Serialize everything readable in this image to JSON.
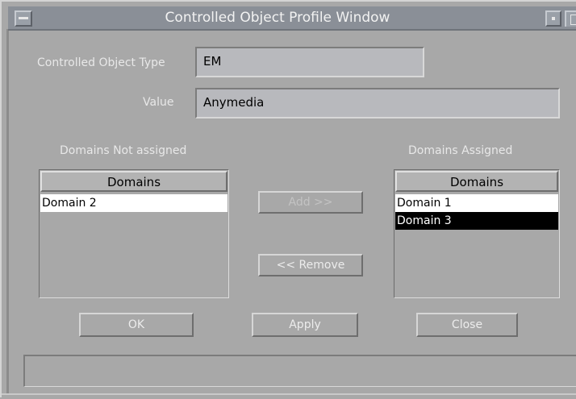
{
  "window": {
    "title": "Controlled Object Profile Window"
  },
  "form": {
    "object_type_label": "Controlled Object Type",
    "object_type_value": "EM",
    "value_label": "Value",
    "value_value": "Anymedia"
  },
  "lists": {
    "not_assigned": {
      "title": "Domains Not assigned",
      "column_header": "Domains",
      "items": [
        "Domain 2"
      ]
    },
    "assigned": {
      "title": "Domains Assigned",
      "column_header": "Domains",
      "items": [
        "Domain 1",
        "Domain 3"
      ],
      "selected_item": "Domain 3"
    }
  },
  "buttons": {
    "add": "Add >>",
    "remove": "<< Remove",
    "ok": "OK",
    "apply": "Apply",
    "close": "Close"
  },
  "status": {
    "text": ""
  }
}
